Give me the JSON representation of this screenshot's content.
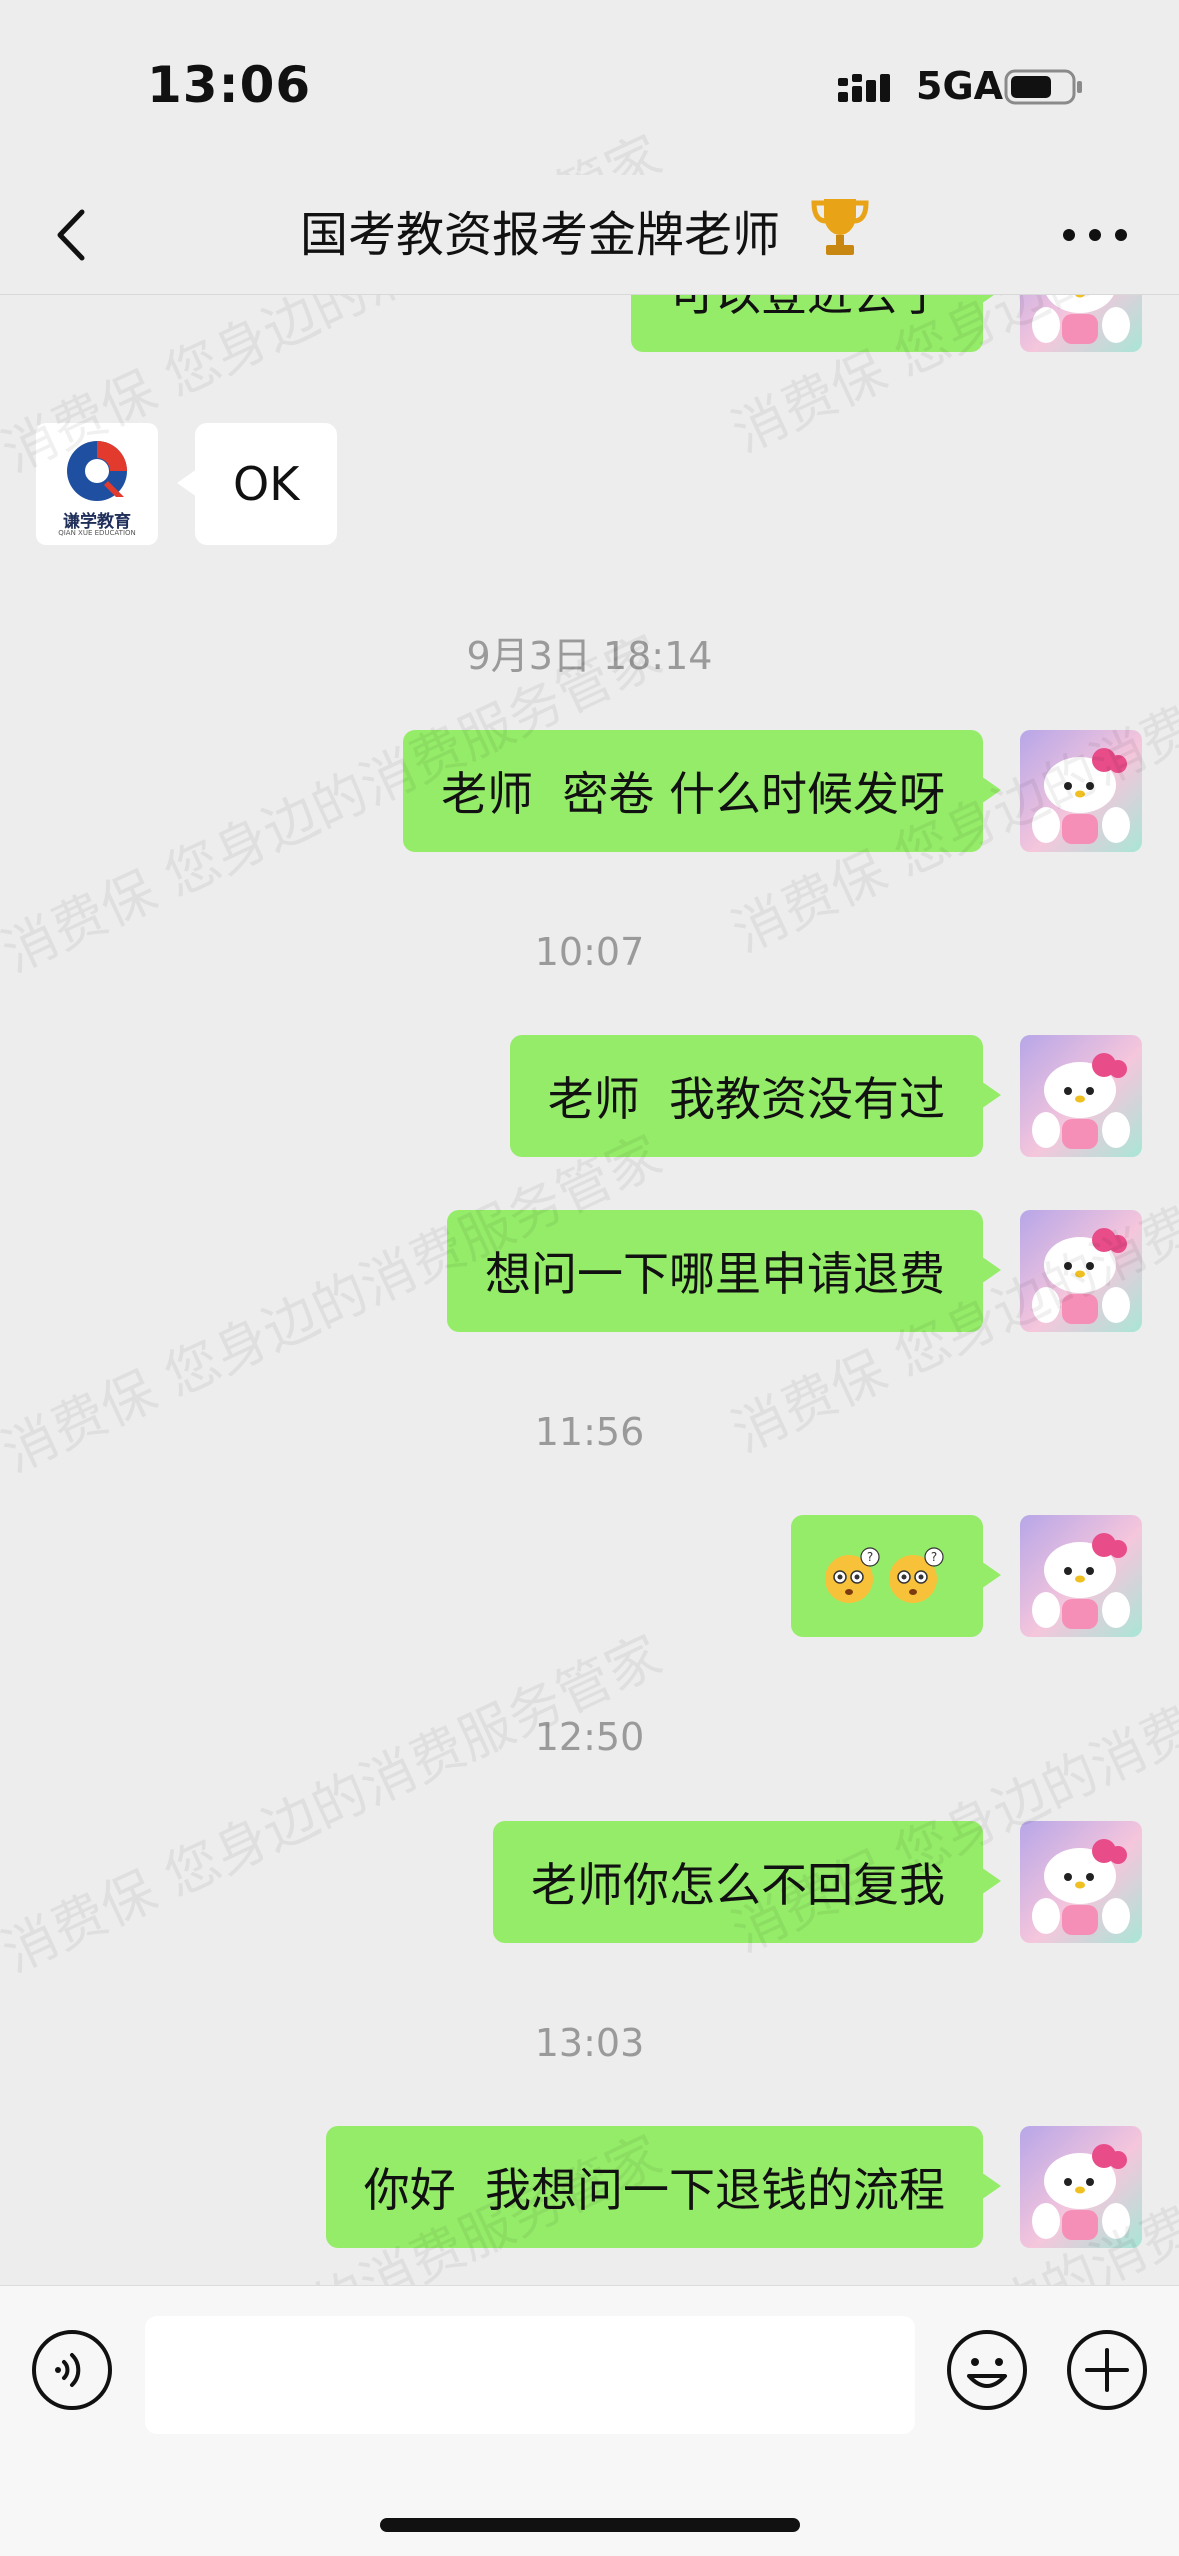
{
  "status_bar": {
    "time": "13:06",
    "network": "5GA"
  },
  "header": {
    "title": "国考教资报考金牌老师",
    "title_emoji": "trophy-icon"
  },
  "watermark_text": "消费保 您身边的消费服务管家",
  "messages": [
    {
      "type": "bubble",
      "side": "me",
      "text": "可以登进去了"
    },
    {
      "type": "bubble",
      "side": "them",
      "text": "OK",
      "avatar": "brand-logo"
    },
    {
      "type": "timestamp",
      "text": "9月3日 18:14"
    },
    {
      "type": "bubble",
      "side": "me",
      "text": "老师  密卷 什么时候发呀"
    },
    {
      "type": "timestamp",
      "text": "10:07"
    },
    {
      "type": "bubble",
      "side": "me",
      "text": "老师  我教资没有过"
    },
    {
      "type": "bubble",
      "side": "me",
      "text": "想问一下哪里申请退费"
    },
    {
      "type": "timestamp",
      "text": "11:56"
    },
    {
      "type": "emoji",
      "side": "me",
      "emoji": "confused-face-icon",
      "count": 2
    },
    {
      "type": "timestamp",
      "text": "12:50"
    },
    {
      "type": "bubble",
      "side": "me",
      "text": "老师你怎么不回复我"
    },
    {
      "type": "timestamp",
      "text": "13:03"
    },
    {
      "type": "bubble",
      "side": "me",
      "text": "你好  我想问一下退钱的流程"
    }
  ],
  "brand": {
    "name": "谦学教育",
    "sub": "QIAN XUE EDUCATION"
  },
  "input": {
    "value": "",
    "placeholder": ""
  },
  "colors": {
    "my_bubble": "#95ec69",
    "their_bubble": "#ffffff",
    "background": "#ededed",
    "timestamp": "#9a9a9a"
  }
}
